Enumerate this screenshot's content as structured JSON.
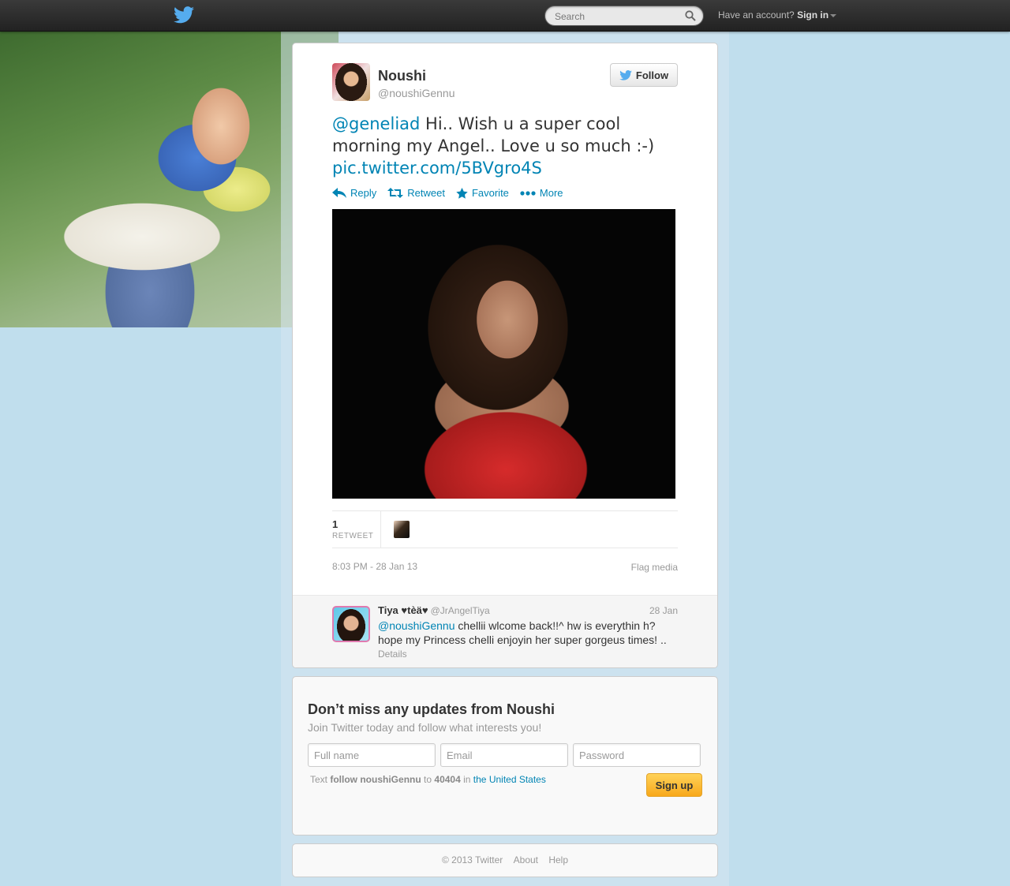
{
  "topbar": {
    "search_placeholder": "Search",
    "account_prefix": "Have an account?",
    "sign_in": "Sign in"
  },
  "tweet": {
    "author_name": "Noushi",
    "author_handle": "@noushiGennu",
    "follow_label": "Follow",
    "mention": "@geneliad",
    "body": " Hi.. Wish u a super cool morning my Angel.. Love u so much :-) ",
    "link": "pic.twitter.com/5BVgro4S",
    "actions": {
      "reply": "Reply",
      "retweet": "Retweet",
      "favorite": "Favorite",
      "more": "More"
    },
    "retweet_count": "1",
    "retweet_label": "RETWEET",
    "timestamp": "8:03 PM - 28 Jan 13",
    "flag": "Flag media"
  },
  "reply": {
    "name": "Tiya ♥tèä♥",
    "handle": "@JrAngelTiya",
    "date": "28 Jan",
    "mention": "@noushiGennu",
    "body": " chellii wlcome back!!^ hw is everythin h? hope my Princess chelli enjoyin her super gorgeus times! ..",
    "details": "Details"
  },
  "signup": {
    "title": "Don’t miss any updates from Noushi",
    "subtitle": "Join Twitter today and follow what interests you!",
    "fullname_placeholder": "Full name",
    "email_placeholder": "Email",
    "password_placeholder": "Password",
    "sms_text": "Text",
    "sms_command": "follow noushiGennu",
    "sms_to": "to",
    "sms_number": "40404",
    "sms_in": "in",
    "sms_country": "the United States",
    "button": "Sign up"
  },
  "footer": {
    "copyright": "© 2013 Twitter",
    "about": "About",
    "help": "Help"
  },
  "colors": {
    "link": "#0084b4",
    "background": "#c0deed",
    "signup_button": "#f8a81b"
  }
}
